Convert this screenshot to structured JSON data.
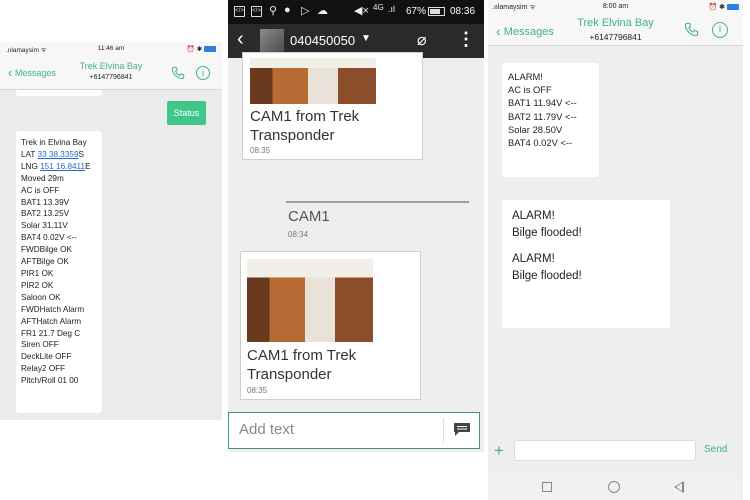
{
  "left_phone": {
    "status": {
      "carrier": "amaysim",
      "time": "11:46 am"
    },
    "nav": {
      "back_label": "Messages",
      "contact_name": "Trek Elvina Bay",
      "contact_number": "+6147796841"
    },
    "sent_message": "Status",
    "received_message": {
      "title": "Trek in Elvina Bay",
      "lat_label": "LAT ",
      "lat_value": "33 38.3359",
      "lat_suffix": "S",
      "lng_label": "LNG ",
      "lng_value": "151 16.8411",
      "lng_suffix": "E",
      "lines": [
        "Moved    29m",
        "AC is OFF",
        "BAT1 13.39V",
        "BAT2 13.25V",
        "Solar   31.11V",
        "BAT4 0.02V <--",
        "FWDBilge OK",
        "AFTBilge OK",
        "PIR1 OK",
        "PIR2 OK",
        "Saloon   OK",
        "FWDHatch Alarm",
        "AFTHatch Alarm",
        "FR1  21.7 Deg C",
        "Siren    OFF",
        "DeckLite OFF",
        "Relay2  OFF",
        "Pitch/Roll  01  00"
      ]
    }
  },
  "middle_phone": {
    "status": {
      "battery_pct": "67%",
      "network": "4G",
      "time": "08:36"
    },
    "header": {
      "contact_number": "040450050"
    },
    "card1": {
      "title": "CAM1 from Trek Transponder",
      "time": "08:35"
    },
    "plain_message": {
      "text": "CAM1",
      "time": "08:34"
    },
    "card2": {
      "title": "CAM1 from Trek Transponder",
      "time": "08:35"
    },
    "input": {
      "placeholder": "Add text"
    }
  },
  "right_phone": {
    "status": {
      "carrier": "amaysim",
      "time": "8:00 am"
    },
    "nav": {
      "back_label": "Messages",
      "contact_name": "Trek Elvina Bay",
      "contact_number": "+6147796841"
    },
    "message1_lines": [
      "ALARM!",
      "AC is OFF",
      "BAT1 11.94V <--",
      "BAT2 11.79V <--",
      "Solar   28.50V",
      "BAT4 0.02V <--"
    ],
    "message2": {
      "line1": "ALARM!",
      "line2": "Bilge flooded!",
      "line3": "ALARM!",
      "line4": "Bilge flooded!"
    },
    "compose": {
      "send_label": "Send"
    }
  },
  "colors": {
    "ios_green": "#3fb37f",
    "bubble_green": "#3fc688",
    "android_dark": "#2a2a2a",
    "link_blue": "#2a66c9"
  }
}
